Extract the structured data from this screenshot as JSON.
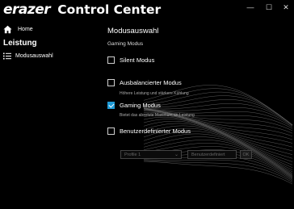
{
  "app": {
    "brand": "erazer",
    "title": "Control Center"
  },
  "window_controls": {
    "minimize": "—",
    "maximize": "☐",
    "close": "✕"
  },
  "sidebar": {
    "home_label": "Home",
    "section_label": "Leistung",
    "items": [
      {
        "label": "Modusauswahl",
        "icon": "list-icon"
      }
    ]
  },
  "main": {
    "title": "Modusauswahl",
    "subtitle": "Gaming Modus",
    "options": [
      {
        "label": "Silent Modus",
        "checked": false,
        "description": ""
      },
      {
        "label": "Ausbalancierter Modus",
        "checked": false,
        "description": "Höhere Leistung und stärkere Kühlung"
      },
      {
        "label": "Gaming Modus",
        "checked": true,
        "description": "Bietet das absolute Maximum an Leistung"
      },
      {
        "label": "Benutzerdefinierter Modus",
        "checked": false,
        "description": ""
      }
    ],
    "profile_select": {
      "value": "Profile 1"
    },
    "custom_input": {
      "value": "Benutzerdefiniert"
    },
    "ok_button": "OK"
  },
  "colors": {
    "accent": "#1e9ad6",
    "background": "#000000"
  }
}
